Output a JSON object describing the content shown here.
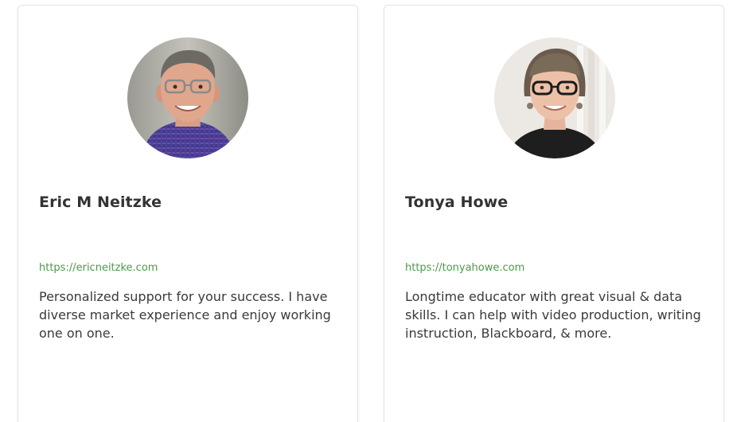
{
  "profiles": [
    {
      "name": "Eric M Neitzke",
      "url": "https://ericneitzke.com",
      "bio": "Personalized support for your success. I have diverse market experience and enjoy working one on one."
    },
    {
      "name": "Tonya Howe",
      "url": "https://tonyahowe.com",
      "bio": "Longtime educator with great visual & data skills. I can help with video production, writing instruction, Blackboard, & more."
    }
  ],
  "colors": {
    "link": "#4a9a4a",
    "name": "#333333",
    "bio": "#3a3a3a",
    "card_border": "#e4e4e4"
  }
}
